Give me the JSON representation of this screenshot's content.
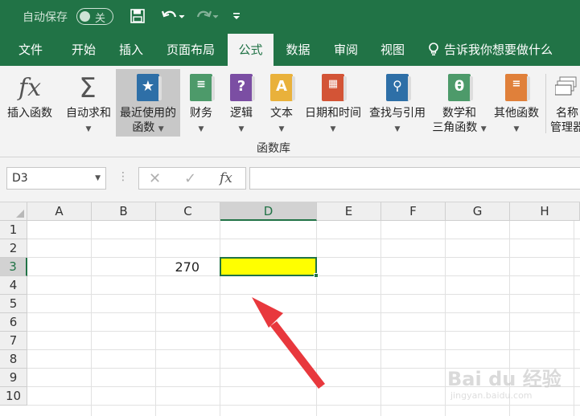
{
  "titlebar": {
    "autosave_label": "自动保存",
    "autosave_state": "关",
    "save_icon": "save-icon",
    "undo_icon": "undo-icon",
    "redo_icon": "redo-icon",
    "customize_icon": "customize-qat-icon"
  },
  "tabs": [
    "文件",
    "开始",
    "插入",
    "页面布局",
    "公式",
    "数据",
    "审阅",
    "视图"
  ],
  "active_tab": "公式",
  "tellme": "告诉我你想要做什么",
  "ribbon": {
    "insert_function": "插入函数",
    "autosum": "自动求和",
    "recently_used_1": "最近使用的",
    "recently_used_2": "函数",
    "financial": "财务",
    "logical": "逻辑",
    "text": "文本",
    "datetime": "日期和时间",
    "lookup": "查找与引用",
    "math_1": "数学和",
    "math_2": "三角函数",
    "more": "其他函数",
    "name_mgr_1": "名称",
    "name_mgr_2": "管理器",
    "group_label": "函数库"
  },
  "formula_bar": {
    "name_box": "D3",
    "fx": "fx",
    "cancel": "✕",
    "enter": "✓",
    "content": ""
  },
  "grid": {
    "columns": [
      "A",
      "B",
      "C",
      "D",
      "E",
      "F",
      "G",
      "H"
    ],
    "rows": [
      "1",
      "2",
      "3",
      "4",
      "5",
      "6",
      "7",
      "8",
      "9",
      "10"
    ],
    "selected_column": "D",
    "selected_row": "3",
    "cells": {
      "C3": "270",
      "D3": ""
    }
  },
  "colors": {
    "accent": "#217346",
    "highlight": "#ffff00",
    "arrow": "#e8383d"
  },
  "watermark": {
    "brand": "Bai du 经验",
    "url": "jingyan.baidu.com"
  }
}
